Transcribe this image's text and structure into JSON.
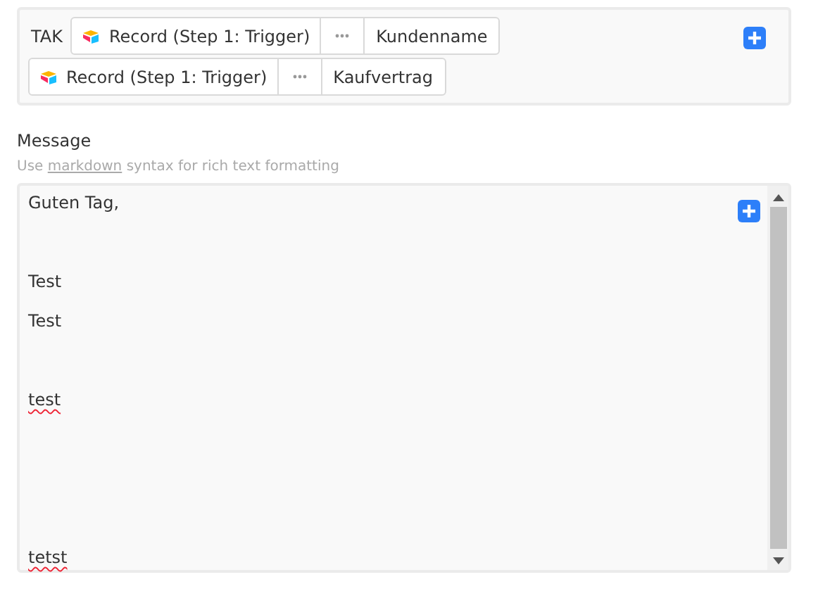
{
  "subject_field": {
    "label": "TAK",
    "tokens": [
      {
        "source": "Record (Step 1: Trigger)",
        "field": "Kundenname"
      },
      {
        "source": "Record (Step 1: Trigger)",
        "field": "Kaufvertrag"
      }
    ]
  },
  "message": {
    "label": "Message",
    "hint_before": "Use",
    "hint_link": "markdown",
    "hint_after": "syntax for rich text formatting",
    "lines": [
      {
        "kind": "text",
        "text": "Guten Tag,",
        "misspelled": false
      },
      {
        "kind": "blank"
      },
      {
        "kind": "text",
        "text": "Test",
        "misspelled": false
      },
      {
        "kind": "text",
        "text": "Test",
        "misspelled": false
      },
      {
        "kind": "blank"
      },
      {
        "kind": "text",
        "text": "test",
        "misspelled": true
      },
      {
        "kind": "blank"
      },
      {
        "kind": "blank"
      },
      {
        "kind": "blank"
      },
      {
        "kind": "text",
        "text": "tetst",
        "misspelled": true
      }
    ]
  }
}
